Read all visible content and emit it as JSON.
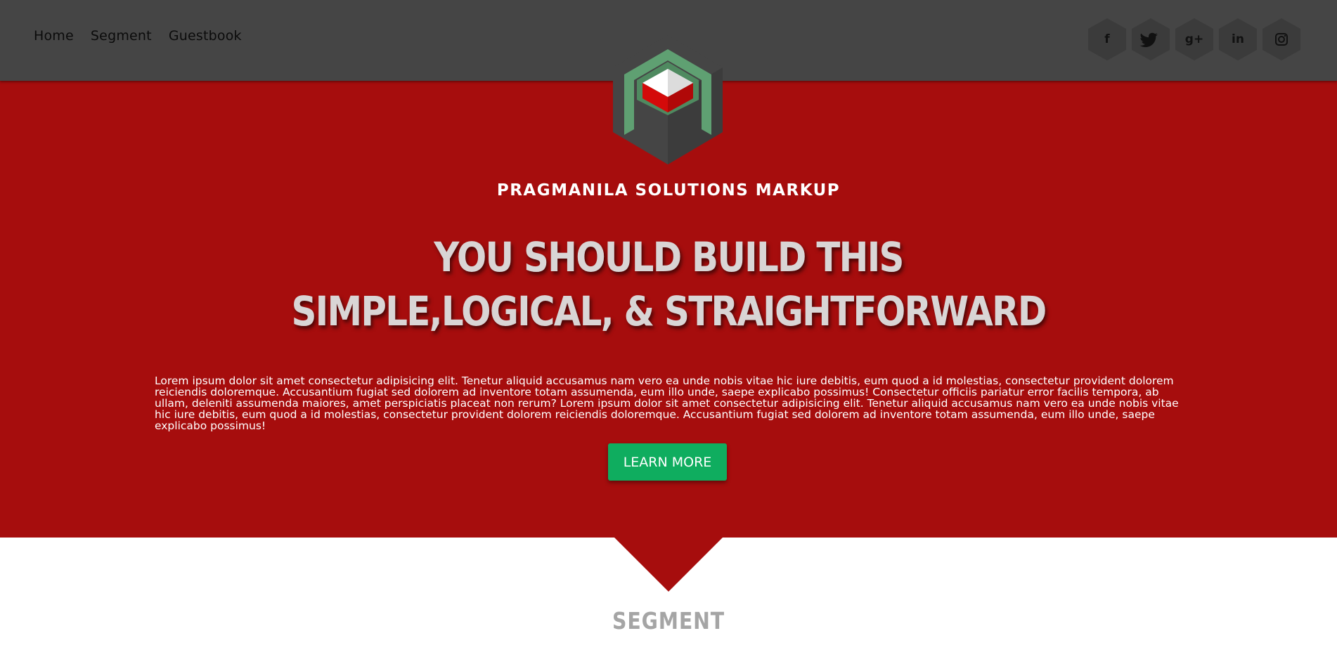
{
  "nav": {
    "items": [
      {
        "label": "Home"
      },
      {
        "label": "Segment"
      },
      {
        "label": "Guestbook"
      }
    ]
  },
  "social": {
    "items": [
      {
        "name": "facebook-icon",
        "glyph": "f"
      },
      {
        "name": "twitter-icon",
        "glyph": "🐦"
      },
      {
        "name": "google-plus-icon",
        "glyph": "g+"
      },
      {
        "name": "linkedin-icon",
        "glyph": "in"
      },
      {
        "name": "instagram-icon",
        "glyph": "◎"
      }
    ]
  },
  "hero": {
    "brand": "PRAGMANILA SOLUTIONS MARKUP",
    "headline_line1": "YOU SHOULD BUILD THIS",
    "headline_line2": "SIMPLE,LOGICAL, & STRAIGHTFORWARD",
    "body": "Lorem ipsum dolor sit amet consectetur adipisicing elit. Tenetur aliquid accusamus nam vero ea unde nobis vitae hic iure debitis, eum quod a id molestias, consectetur provident dolorem reiciendis doloremque. Accusantium fugiat sed dolorem ad inventore totam assumenda, eum illo unde, saepe explicabo possimus! Consectetur officiis pariatur error facilis tempora, ab ullam, deleniti assumenda maiores, amet perspiciatis placeat non rerum? Lorem ipsum dolor sit amet consectetur adipisicing elit. Tenetur aliquid accusamus nam vero ea unde nobis vitae hic iure debitis, eum quod a id molestias, consectetur provident dolorem reiciendis doloremque. Accusantium fugiat sed dolorem ad inventore totam assumenda, eum illo unde, saepe explicabo possimus!",
    "button_label": "LEARN MORE"
  },
  "segment": {
    "title": "SEGMENT"
  },
  "colors": {
    "topbar": "#454545",
    "hero": "#a60d0d",
    "button": "#0fad5f",
    "logo_green": "#5fa072",
    "logo_red": "#d40a0a"
  }
}
